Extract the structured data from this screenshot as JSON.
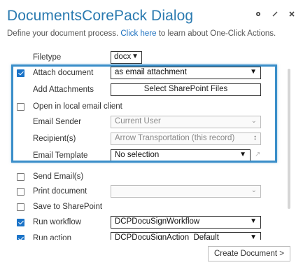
{
  "dialog": {
    "title": "DocumentsCorePack Dialog",
    "subtitle_pre": "Define your document process.",
    "subtitle_link": "Click here",
    "subtitle_post": "to learn about One-Click Actions."
  },
  "fields": {
    "filetype": {
      "label": "Filetype",
      "value": "docx"
    },
    "attach_document": {
      "label": "Attach document",
      "checked": true,
      "value": "as email attachment"
    },
    "add_attachments": {
      "label": "Add Attachments",
      "button": "Select SharePoint Files"
    },
    "open_local_email": {
      "label": "Open in local email client",
      "checked": false
    },
    "email_sender": {
      "label": "Email Sender",
      "value": "Current User"
    },
    "recipients": {
      "label": "Recipient(s)",
      "value": "Arrow Transportation (this record)"
    },
    "email_template": {
      "label": "Email Template",
      "value": "No selection"
    },
    "send_email": {
      "label": "Send Email(s)",
      "checked": false
    },
    "print_document": {
      "label": "Print document",
      "checked": false,
      "value": ""
    },
    "save_sharepoint": {
      "label": "Save to SharePoint",
      "checked": false
    },
    "run_workflow": {
      "label": "Run workflow",
      "checked": true,
      "value": "DCPDocuSignWorkflow"
    },
    "run_action": {
      "label": "Run action",
      "checked": true,
      "value": "DCPDocuSignAction_Default"
    }
  },
  "footer": {
    "create_button": "Create Document >"
  },
  "colors": {
    "accent": "#2a7ab0",
    "checkbox": "#1a73c8",
    "highlight": "#3a8ec9"
  },
  "icons": {
    "header": [
      "gear-icon",
      "edit-icon",
      "close-icon"
    ],
    "external": "external-link-icon"
  }
}
